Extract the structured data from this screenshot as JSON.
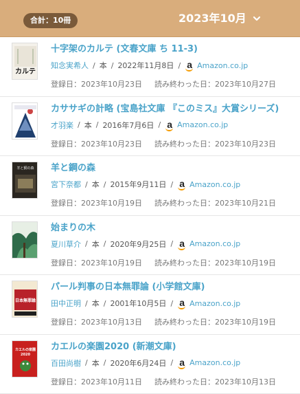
{
  "header": {
    "total_label": "合計：10冊",
    "month_label": "2023年10月"
  },
  "books": [
    {
      "title": "十字架のカルテ (文春文庫 ち 11-3)",
      "author": "知念実希人",
      "type": "本",
      "published": "2022年11月8日",
      "store": "Amazon.co.jp",
      "registered": "登録日：2023年10月23日",
      "finished": "読み終わった日：2023年10月27日",
      "cover_text": "十字架のカルテ"
    },
    {
      "title": "カササギの計略 (宝島社文庫 『このミス』大賞シリーズ)",
      "author": "才羽楽",
      "type": "本",
      "published": "2016年7月6日",
      "store": "Amazon.co.jp",
      "registered": "登録日：2023年10月23日",
      "finished": "読み終わった日：2023年10月23日",
      "cover_text": ""
    },
    {
      "title": "羊と鋼の森",
      "author": "宮下奈都",
      "type": "本",
      "published": "2015年9月11日",
      "store": "Amazon.co.jp",
      "registered": "登録日：2023年10月19日",
      "finished": "読み終わった日：2023年10月21日",
      "cover_text": "羊と鋼の森"
    },
    {
      "title": "始まりの木",
      "author": "夏川草介",
      "type": "本",
      "published": "2020年9月25日",
      "store": "Amazon.co.jp",
      "registered": "登録日：2023年10月19日",
      "finished": "読み終わった日：2023年10月19日",
      "cover_text": ""
    },
    {
      "title": "パール判事の日本無罪論 (小学館文庫)",
      "author": "田中正明",
      "type": "本",
      "published": "2001年10月5日",
      "store": "Amazon.co.jp",
      "registered": "登録日：2023年10月13日",
      "finished": "読み終わった日：2023年10月19日",
      "cover_text": "日本無罪論"
    },
    {
      "title": "カエルの楽園2020 (新潮文庫)",
      "author": "百田尚樹",
      "type": "本",
      "published": "2020年6月24日",
      "store": "Amazon.co.jp",
      "registered": "登録日：2023年10月11日",
      "finished": "読み終わった日：2023年10月13日",
      "cover_text": "カエルの楽園2020"
    }
  ],
  "colors": {
    "header_bg": "#d9ad7c",
    "badge_bg": "#7a5a3a",
    "link": "#4aa3c9",
    "amazon_orange": "#f59b00"
  }
}
